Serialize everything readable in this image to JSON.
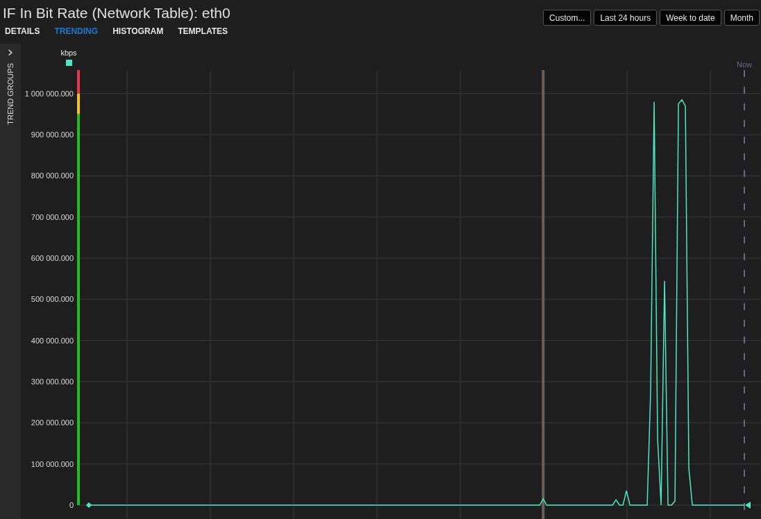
{
  "title": "IF In Bit Rate (Network Table): eth0",
  "tabs": [
    {
      "label": "DETAILS",
      "selected": false
    },
    {
      "label": "TRENDING",
      "selected": true
    },
    {
      "label": "HISTOGRAM",
      "selected": false
    },
    {
      "label": "TEMPLATES",
      "selected": false
    }
  ],
  "range_buttons": [
    "Custom...",
    "Last 24 hours",
    "Week to date",
    "Month"
  ],
  "sidebar": {
    "label": "TREND GROUPS",
    "chevron": "›"
  },
  "chart": {
    "thresholds": [
      {
        "color": "#1fbf1f"
      },
      {
        "color": "#f2c31c"
      },
      {
        "color": "#e8374a"
      }
    ],
    "now_label": "Now",
    "chart_data": {
      "type": "line",
      "grid": true,
      "ylim": [
        0,
        1057000
      ],
      "yticks": [
        {
          "value": 0,
          "label": "0"
        },
        {
          "value": 100000,
          "label": "100 000.000"
        },
        {
          "value": 200000,
          "label": "200 000.000"
        },
        {
          "value": 300000,
          "label": "300 000.000"
        },
        {
          "value": 400000,
          "label": "400 000.000"
        },
        {
          "value": 500000,
          "label": "500 000.000"
        },
        {
          "value": 600000,
          "label": "600 000.000"
        },
        {
          "value": 700000,
          "label": "700 000.000"
        },
        {
          "value": 800000,
          "label": "800 000.000"
        },
        {
          "value": 900000,
          "label": "900 000.000"
        },
        {
          "value": 1000000,
          "label": "1 000 000.000"
        }
      ],
      "categories": [
        null,
        null,
        null,
        null,
        null,
        null,
        null,
        null,
        null,
        null,
        null,
        null,
        null,
        null,
        null,
        null,
        null,
        null,
        null,
        null,
        null,
        null,
        null,
        null,
        null,
        null,
        null,
        null,
        null,
        null,
        null,
        null,
        null,
        null,
        null,
        null,
        null,
        null,
        null,
        null,
        null,
        null,
        null,
        null,
        null,
        null,
        null,
        null,
        null,
        null,
        null,
        null,
        null,
        null,
        null,
        null,
        null,
        null,
        null,
        null,
        null,
        null,
        null,
        null,
        null,
        null,
        null,
        null,
        null,
        null,
        null,
        null,
        null,
        null,
        null,
        null,
        null,
        null,
        null,
        null,
        null,
        null,
        null,
        null,
        null,
        null,
        null,
        null,
        null,
        null,
        null,
        null,
        null,
        null,
        null,
        null,
        null,
        null,
        null,
        null,
        null,
        null,
        null,
        null,
        null,
        null,
        null,
        null,
        null,
        null,
        null,
        null,
        null,
        null,
        null,
        null,
        null,
        null,
        null,
        null,
        null,
        null,
        null,
        null,
        null,
        null,
        null,
        null,
        null,
        null,
        null,
        null,
        null,
        null,
        null,
        null,
        null,
        null,
        null,
        null,
        null,
        null,
        null,
        null,
        null,
        null,
        null,
        null,
        null,
        null,
        null,
        null,
        null,
        null,
        null,
        null,
        null,
        null,
        null,
        null,
        null,
        null,
        null,
        null,
        null,
        null,
        null,
        null,
        null,
        null,
        null,
        null,
        null,
        null,
        null,
        null,
        null,
        null,
        null,
        null,
        null,
        null,
        null,
        null,
        null,
        null,
        null,
        null,
        null,
        null
      ],
      "series": [
        {
          "name": "kbps",
          "color": "#4de8c2",
          "values": [
            0,
            0,
            0,
            0,
            0,
            0,
            0,
            0,
            0,
            0,
            0,
            0,
            0,
            0,
            0,
            0,
            0,
            0,
            0,
            0,
            0,
            0,
            0,
            0,
            0,
            0,
            0,
            0,
            0,
            0,
            0,
            0,
            0,
            0,
            0,
            0,
            0,
            0,
            0,
            0,
            0,
            0,
            0,
            0,
            0,
            0,
            0,
            0,
            0,
            0,
            0,
            0,
            0,
            0,
            0,
            0,
            0,
            0,
            0,
            0,
            0,
            0,
            0,
            0,
            0,
            0,
            0,
            0,
            0,
            0,
            0,
            0,
            0,
            0,
            0,
            0,
            0,
            0,
            0,
            0,
            0,
            0,
            0,
            0,
            0,
            0,
            0,
            0,
            0,
            0,
            0,
            0,
            0,
            0,
            0,
            0,
            0,
            0,
            0,
            0,
            0,
            0,
            0,
            0,
            0,
            0,
            0,
            0,
            0,
            0,
            0,
            0,
            0,
            0,
            0,
            0,
            0,
            0,
            0,
            0,
            0,
            0,
            0,
            0,
            0,
            0,
            0,
            0,
            0,
            0,
            0,
            15000,
            0,
            0,
            0,
            0,
            0,
            0,
            0,
            0,
            0,
            0,
            0,
            0,
            0,
            0,
            0,
            0,
            0,
            0,
            0,
            0,
            13000,
            0,
            0,
            35000,
            0,
            0,
            0,
            0,
            0,
            0,
            280000,
            980000,
            160000,
            0,
            545000,
            0,
            0,
            10000,
            975000,
            985000,
            970000,
            90000,
            0,
            0,
            0,
            0,
            0,
            0,
            0,
            0,
            0,
            0,
            0,
            0,
            0,
            0,
            0,
            0
          ]
        }
      ]
    }
  }
}
